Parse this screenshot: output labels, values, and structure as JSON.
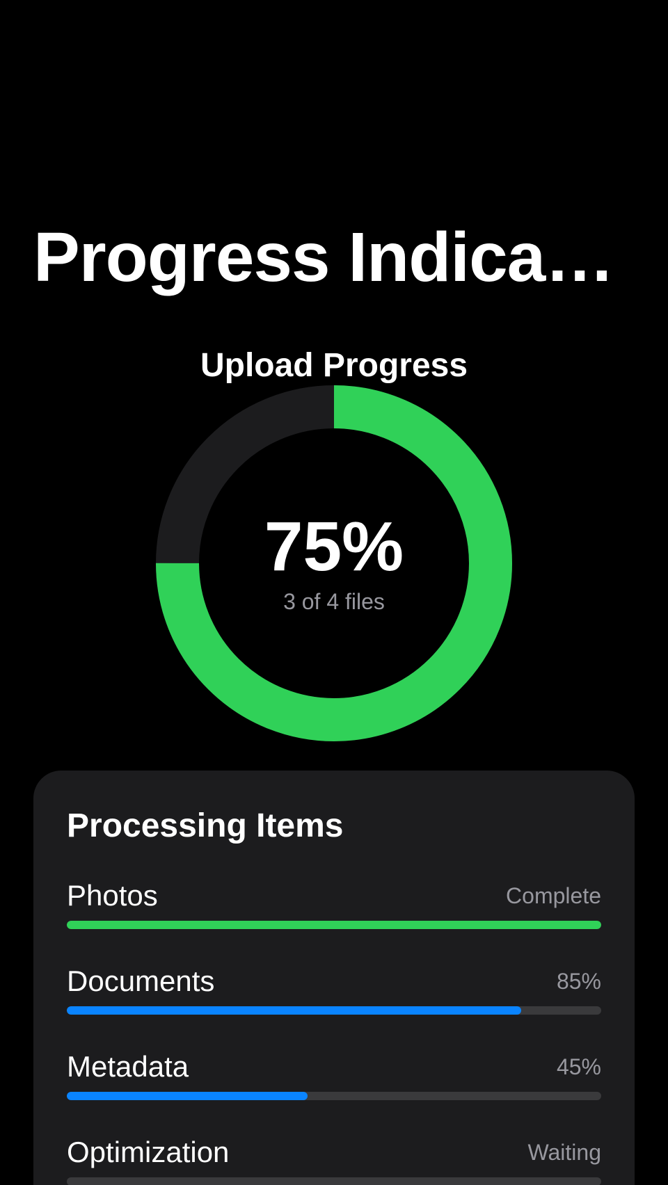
{
  "header": {
    "title": "Progress Indicato…"
  },
  "upload": {
    "title": "Upload Progress",
    "percent_label": "75%",
    "progress": 0.75,
    "subtitle": "3 of 4 files",
    "progress_color": "#30d158",
    "track_color": "#1c1c1e"
  },
  "processing": {
    "title": "Processing Items",
    "items": [
      {
        "label": "Photos",
        "status": "Complete",
        "progress": 1.0,
        "color": "#30d158"
      },
      {
        "label": "Documents",
        "status": "85%",
        "progress": 0.85,
        "color": "#0a84ff"
      },
      {
        "label": "Metadata",
        "status": "45%",
        "progress": 0.45,
        "color": "#0a84ff"
      },
      {
        "label": "Optimization",
        "status": "Waiting",
        "progress": 0.0,
        "color": "#0a84ff"
      }
    ]
  }
}
